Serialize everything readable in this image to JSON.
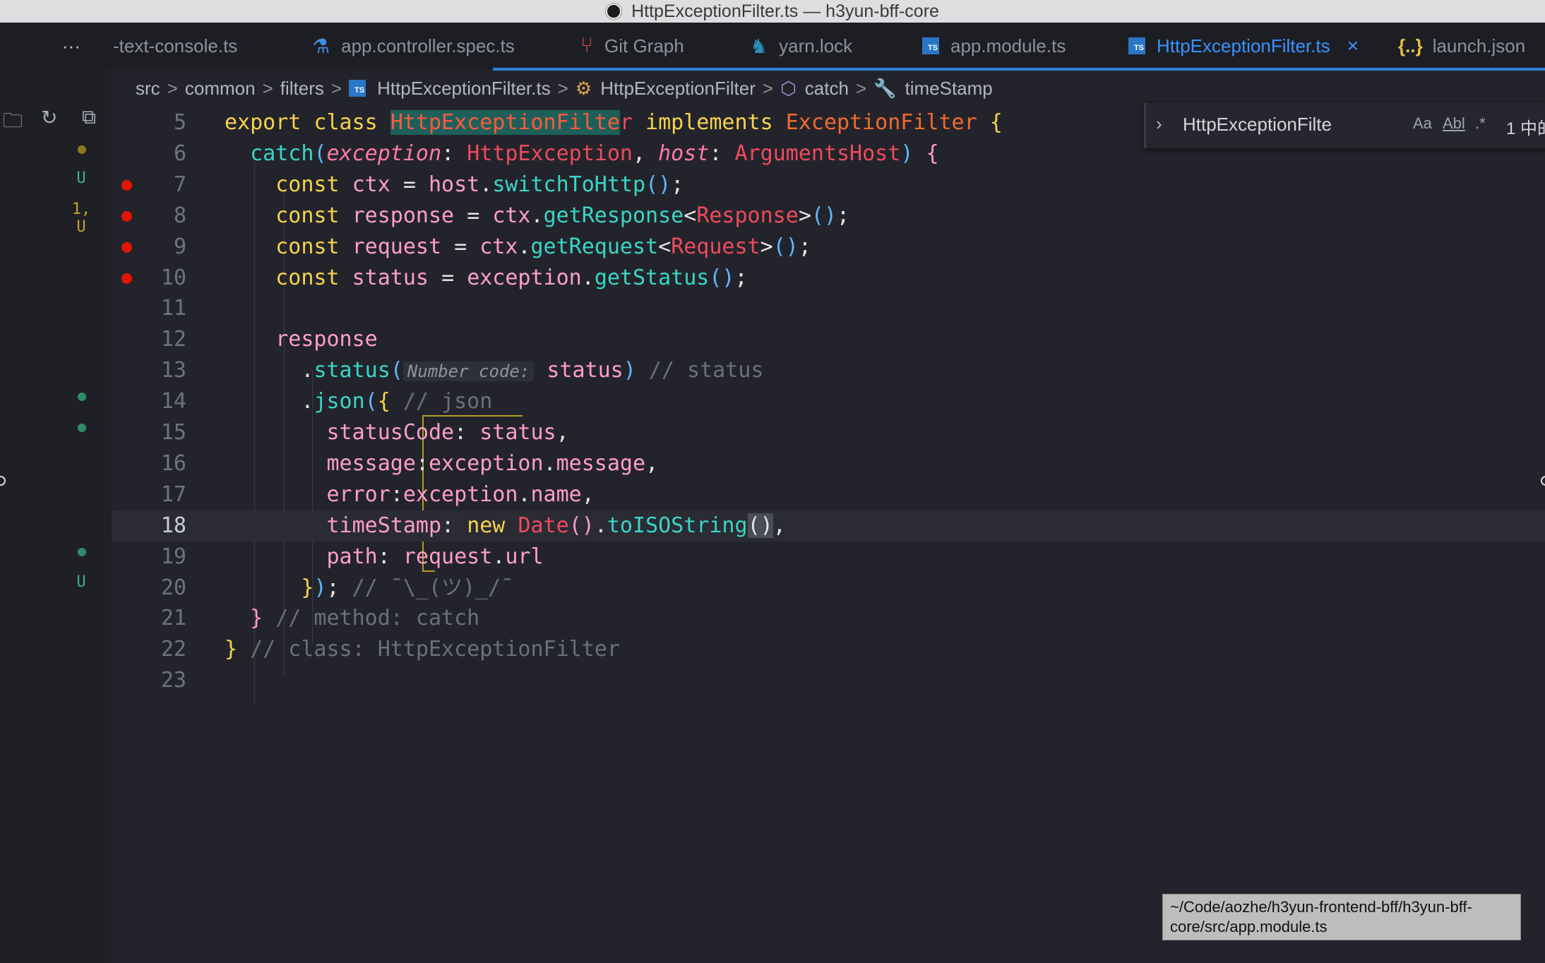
{
  "window": {
    "title": "HttpExceptionFilter.ts — h3yun-bff-core"
  },
  "tabs": [
    {
      "label": "-text-console.ts",
      "icon": "none"
    },
    {
      "label": "app.controller.spec.ts",
      "icon": "flask-icon"
    },
    {
      "label": "Git Graph",
      "icon": "git-graph-icon"
    },
    {
      "label": "yarn.lock",
      "icon": "yarn-icon"
    },
    {
      "label": "app.module.ts",
      "icon": "typescript-icon"
    },
    {
      "label": "HttpExceptionFilter.ts",
      "icon": "typescript-icon",
      "active": true,
      "close": "×"
    },
    {
      "label": "launch.json",
      "icon": "json-icon",
      "icon_text": "{..}"
    }
  ],
  "more_tabs": "···",
  "breadcrumb": {
    "items": [
      "src",
      "common",
      "filters",
      "HttpExceptionFilter.ts",
      "HttpExceptionFilter",
      "catch",
      "timeStamp"
    ],
    "separator": ">"
  },
  "sidebar": {
    "git_marks": [
      {
        "line": 7,
        "text": "U",
        "color": "#3fae8f"
      },
      {
        "line": 8,
        "text": "1, U",
        "color": "#c9a227"
      }
    ],
    "git_dots": [
      {
        "line": 6,
        "color": "#8c7a1e"
      },
      {
        "line": 14,
        "color": "#2e8b6a"
      },
      {
        "line": 15,
        "color": "#2e8b6a"
      },
      {
        "line": 19,
        "color": "#2e8b6a"
      }
    ],
    "git_u_line20": "U"
  },
  "editor": {
    "first_line": 5,
    "current_line": 18,
    "breakpoints": [
      7,
      8,
      9,
      10
    ],
    "lines": [
      {
        "n": "5",
        "tokens": [
          [
            "k",
            "export "
          ],
          [
            "k",
            "class "
          ],
          [
            "hl",
            "HttpExceptionFilte"
          ],
          [
            "t",
            "r"
          ],
          [
            "v",
            " "
          ],
          [
            "k",
            "implements "
          ],
          [
            "cls",
            "ExceptionFilter "
          ],
          [
            "yb",
            "{"
          ]
        ]
      },
      {
        "n": "6",
        "tokens": [
          [
            "v",
            "  "
          ],
          [
            "f",
            "catch"
          ],
          [
            "bl",
            "("
          ],
          [
            "it",
            "exception"
          ],
          [
            "punc",
            ": "
          ],
          [
            "t",
            "HttpException"
          ],
          [
            "punc",
            ", "
          ],
          [
            "it",
            "host"
          ],
          [
            "punc",
            ": "
          ],
          [
            "t",
            "ArgumentsHost"
          ],
          [
            "bl",
            ")"
          ],
          [
            "punc",
            " "
          ],
          [
            "pr",
            "{"
          ]
        ]
      },
      {
        "n": "7",
        "tokens": [
          [
            "v",
            "    "
          ],
          [
            "k",
            "const "
          ],
          [
            "pr",
            "ctx "
          ],
          [
            "punc",
            "= "
          ],
          [
            "pr",
            "host"
          ],
          [
            "punc",
            "."
          ],
          [
            "f",
            "switchToHttp"
          ],
          [
            "bl",
            "()"
          ],
          [
            "punc",
            ";"
          ]
        ]
      },
      {
        "n": "8",
        "tokens": [
          [
            "v",
            "    "
          ],
          [
            "k",
            "const "
          ],
          [
            "pr",
            "response "
          ],
          [
            "punc",
            "= "
          ],
          [
            "pr",
            "ctx"
          ],
          [
            "punc",
            "."
          ],
          [
            "f",
            "getResponse"
          ],
          [
            "punc",
            "<"
          ],
          [
            "t",
            "Response"
          ],
          [
            "punc",
            ">"
          ],
          [
            "bl",
            "()"
          ],
          [
            "punc",
            ";"
          ]
        ]
      },
      {
        "n": "9",
        "tokens": [
          [
            "v",
            "    "
          ],
          [
            "k",
            "const "
          ],
          [
            "pr",
            "request "
          ],
          [
            "punc",
            "= "
          ],
          [
            "pr",
            "ctx"
          ],
          [
            "punc",
            "."
          ],
          [
            "f",
            "getRequest"
          ],
          [
            "punc",
            "<"
          ],
          [
            "t",
            "Request"
          ],
          [
            "punc",
            ">"
          ],
          [
            "bl",
            "()"
          ],
          [
            "punc",
            ";"
          ]
        ]
      },
      {
        "n": "10",
        "tokens": [
          [
            "v",
            "    "
          ],
          [
            "k",
            "const "
          ],
          [
            "pr",
            "status "
          ],
          [
            "punc",
            "= "
          ],
          [
            "pr",
            "exception"
          ],
          [
            "punc",
            "."
          ],
          [
            "f",
            "getStatus"
          ],
          [
            "bl",
            "()"
          ],
          [
            "punc",
            ";"
          ]
        ]
      },
      {
        "n": "11",
        "tokens": []
      },
      {
        "n": "12",
        "tokens": [
          [
            "v",
            "    "
          ],
          [
            "pr",
            "response"
          ]
        ]
      },
      {
        "n": "13",
        "tokens": [
          [
            "v",
            "      "
          ],
          [
            "punc",
            "."
          ],
          [
            "f",
            "status"
          ],
          [
            "bl",
            "("
          ],
          [
            "hint",
            "Number code:"
          ],
          [
            "pr",
            " status"
          ],
          [
            "bl",
            ")"
          ],
          [
            "c",
            " // status"
          ]
        ]
      },
      {
        "n": "14",
        "tokens": [
          [
            "v",
            "      "
          ],
          [
            "punc",
            "."
          ],
          [
            "f",
            "json"
          ],
          [
            "bl",
            "("
          ],
          [
            "yb",
            "{"
          ],
          [
            "c",
            " // json"
          ]
        ]
      },
      {
        "n": "15",
        "tokens": [
          [
            "v",
            "        "
          ],
          [
            "pr",
            "statusCode"
          ],
          [
            "punc",
            ": "
          ],
          [
            "pr",
            "status"
          ],
          [
            "punc",
            ","
          ]
        ]
      },
      {
        "n": "16",
        "tokens": [
          [
            "v",
            "        "
          ],
          [
            "pr",
            "message"
          ],
          [
            "punc",
            ":"
          ],
          [
            "pr",
            "exception"
          ],
          [
            "punc",
            "."
          ],
          [
            "pr",
            "message"
          ],
          [
            "punc",
            ","
          ]
        ]
      },
      {
        "n": "17",
        "tokens": [
          [
            "v",
            "        "
          ],
          [
            "pr",
            "error"
          ],
          [
            "punc",
            ":"
          ],
          [
            "pr",
            "exception"
          ],
          [
            "punc",
            "."
          ],
          [
            "pr",
            "name"
          ],
          [
            "punc",
            ","
          ]
        ]
      },
      {
        "n": "18",
        "tokens": [
          [
            "v",
            "        "
          ],
          [
            "pr",
            "timeStamp"
          ],
          [
            "punc",
            ": "
          ],
          [
            "k",
            "new "
          ],
          [
            "t",
            "Date"
          ],
          [
            "pr",
            "()"
          ],
          [
            "punc",
            "."
          ],
          [
            "f",
            "toISOString"
          ],
          [
            "brhl",
            "()"
          ],
          [
            "punc",
            ","
          ]
        ]
      },
      {
        "n": "19",
        "tokens": [
          [
            "v",
            "        "
          ],
          [
            "pr",
            "path"
          ],
          [
            "punc",
            ": "
          ],
          [
            "pr",
            "request"
          ],
          [
            "punc",
            "."
          ],
          [
            "pr",
            "url"
          ]
        ]
      },
      {
        "n": "20",
        "tokens": [
          [
            "v",
            "      "
          ],
          [
            "yb",
            "}"
          ],
          [
            "bl",
            ")"
          ],
          [
            "punc",
            ";"
          ],
          [
            "c",
            " // ¯\\_(ツ)_/¯"
          ]
        ]
      },
      {
        "n": "21",
        "tokens": [
          [
            "v",
            "  "
          ],
          [
            "pr",
            "}"
          ],
          [
            "c",
            " // method: catch"
          ]
        ]
      },
      {
        "n": "22",
        "tokens": [
          [
            "yb",
            "}"
          ],
          [
            "c",
            " // class: HttpExceptionFilter"
          ]
        ]
      },
      {
        "n": "23",
        "tokens": []
      }
    ]
  },
  "find": {
    "value": "HttpExceptionFilte",
    "match_case": "Aa",
    "whole_word": "Abl",
    "regex": ".*",
    "result": "1 中的"
  },
  "tooltip": {
    "text": "~/Code/aozhe/h3yun-frontend-bff/h3yun-bff-core/src/app.module.ts"
  }
}
